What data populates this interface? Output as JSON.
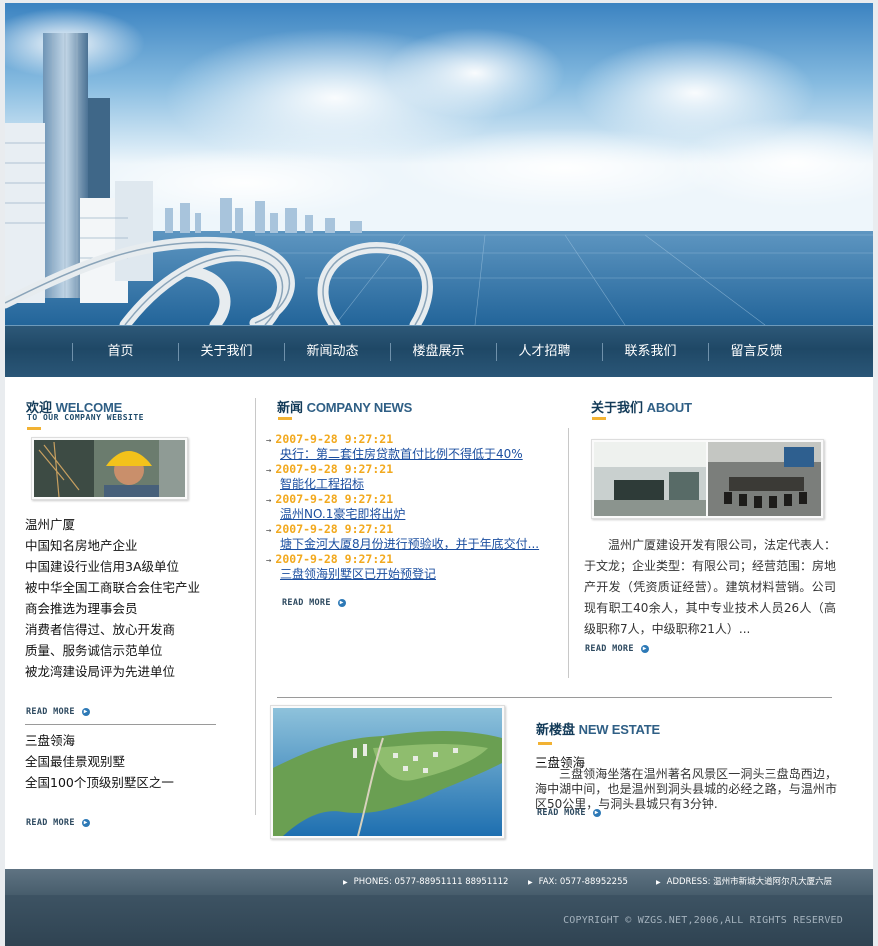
{
  "nav": {
    "items": [
      "首页",
      "关于我们",
      "新闻动态",
      "楼盘展示",
      "人才招聘",
      "联系我们",
      "留言反馈"
    ]
  },
  "welcome": {
    "title_cn": "欢迎",
    "title_en": "WELCOME",
    "subtitle": "TO OUR COMPANY WEBSITE",
    "honors": [
      "温州广厦",
      "中国知名房地产企业",
      "中国建设行业信用3A级单位",
      "被中华全国工商联合会住宅产业",
      "商会推选为理事会员",
      "消费者信得过、放心开发商",
      "质量、服务诚信示范单位",
      "被龙湾建设局评为先进单位"
    ],
    "read_more_1": "READ MORE",
    "villa_lines": [
      "三盘领海",
      "全国最佳景观别墅",
      "全国100个顶级别墅区之一"
    ],
    "read_more_2": "READ MORE"
  },
  "news": {
    "title_cn": "新闻",
    "title_en": "COMPANY NEWS",
    "items": [
      {
        "date": "2007-9-28 9:27:21",
        "title": "央行：第二套住房贷款首付比例不得低于40%"
      },
      {
        "date": "2007-9-28 9:27:21",
        "title": "智能化工程招标"
      },
      {
        "date": "2007-9-28 9:27:21",
        "title": "温州NO.1豪宅即将出炉"
      },
      {
        "date": "2007-9-28 9:27:21",
        "title": "塘下金河大厦8月份进行预验收，并于年底交付..."
      },
      {
        "date": "2007-9-28 9:27:21",
        "title": "三盘领海别墅区已开始预登记"
      }
    ],
    "read_more": "READ MORE"
  },
  "about": {
    "title_cn": "关于我们",
    "title_en": "ABOUT",
    "text": "温州广厦建设开发有限公司，法定代表人：于文龙；企业类型：有限公司；经营范围：房地产开发（凭资质证经营）。建筑材料营销。公司现有职工40余人，其中专业技术人员26人（高级职称7人，中级职称21人）...",
    "read_more": "READ MORE"
  },
  "estate": {
    "title_cn": "新楼盘",
    "title_en": "NEW ESTATE",
    "name": "三盘领海",
    "text": "三盘领海坐落在温州著名风景区一洞头三盘岛西边，海中湖中间，也是温州到洞头县城的必经之路，与温州市区50公里，与洞头县城只有3分钟.",
    "read_more": "READ MORE"
  },
  "footer": {
    "phones": "PHONES: 0577-88951111 88951112",
    "fax": "FAX: 0577-88952255",
    "address": "ADDRESS: 温州市新城大道阿尔凡大厦六层",
    "copyright": "COPYRIGHT © WZGS.NET,2006,ALL RIGHTS RESERVED"
  },
  "icons": {
    "arrow": "arrow-right-icon",
    "read_more": "circle-arrow-icon",
    "footer_marker": "triangle-right-icon"
  },
  "colors": {
    "nav_bg": "#1f4866",
    "accent": "#f2b233",
    "date": "#f2a91e",
    "link": "#1c4fa0",
    "footer": "#475d6c"
  }
}
